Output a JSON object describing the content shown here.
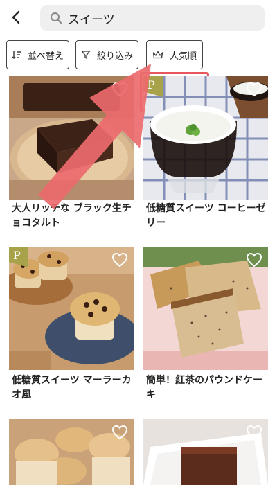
{
  "search": {
    "query": "スイーツ"
  },
  "filters": {
    "sort_label": "並べ替え",
    "narrow_label": "絞り込み",
    "popular_label": "人気順"
  },
  "recipes": [
    {
      "title": "大人リッチな ブラック生チョコタルト",
      "premium": false
    },
    {
      "title": "低糖質スイーツ コーヒーゼリー",
      "premium": true,
      "badge": "P"
    },
    {
      "title": "低糖質スイーツ マーラーカオ風",
      "premium": true,
      "badge": "P"
    },
    {
      "title": "簡単！紅茶のパウンドケーキ",
      "premium": false
    },
    {
      "title": "",
      "premium": false
    },
    {
      "title": "",
      "premium": false
    }
  ],
  "colors": {
    "highlight": "#e8575c",
    "arrow": "#ec6a6c",
    "badge": "#a8a24a"
  },
  "icons": [
    "back-chevron-icon",
    "search-icon",
    "sort-icon",
    "filter-funnel-icon",
    "crown-icon",
    "heart-icon"
  ]
}
